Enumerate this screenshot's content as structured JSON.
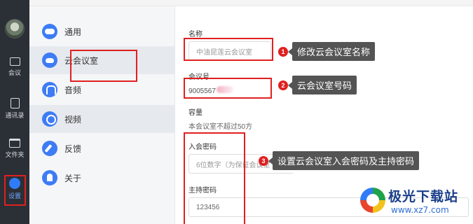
{
  "rail": {
    "items": [
      {
        "label": "会议",
        "icon": "camera-icon"
      },
      {
        "label": "通讯录",
        "icon": "contacts-icon"
      },
      {
        "label": "文件夹",
        "icon": "folder-icon"
      },
      {
        "label": "设置",
        "icon": "settings-hex-icon"
      }
    ]
  },
  "menu": {
    "items": [
      {
        "label": "通用",
        "icon": "toggle-icon"
      },
      {
        "label": "云会议室",
        "icon": "cloud-icon"
      },
      {
        "label": "音频",
        "icon": "headphones-icon"
      },
      {
        "label": "视频",
        "icon": "webcam-icon"
      },
      {
        "label": "反馈",
        "icon": "pencil-icon"
      },
      {
        "label": "关于",
        "icon": "lightbulb-icon"
      }
    ],
    "active": "云会议室"
  },
  "form": {
    "name_label": "名称",
    "name_value": "中油昆莲云会议室",
    "room_number_label": "会议号",
    "room_number_value": "9005567",
    "capacity_label": "容量",
    "capacity_text": "本会议室不超过50方",
    "entry_password_label": "入会密码",
    "entry_password_placeholder": "6位数字（为保证会议室",
    "host_password_label": "主持密码",
    "host_password_value": "123456"
  },
  "callouts": [
    {
      "num": "1",
      "text": "修改云会议室名称"
    },
    {
      "num": "2",
      "text": "云会议室号码"
    },
    {
      "num": "3",
      "text": "设置云会议室入会密码及主持密码"
    }
  ],
  "watermark": {
    "title": "极光下载站",
    "url": "www.xz7.com"
  },
  "colors": {
    "accent": "#2f7cf6",
    "annotation_red": "#e02020",
    "rail_bg": "#2b2f36"
  }
}
